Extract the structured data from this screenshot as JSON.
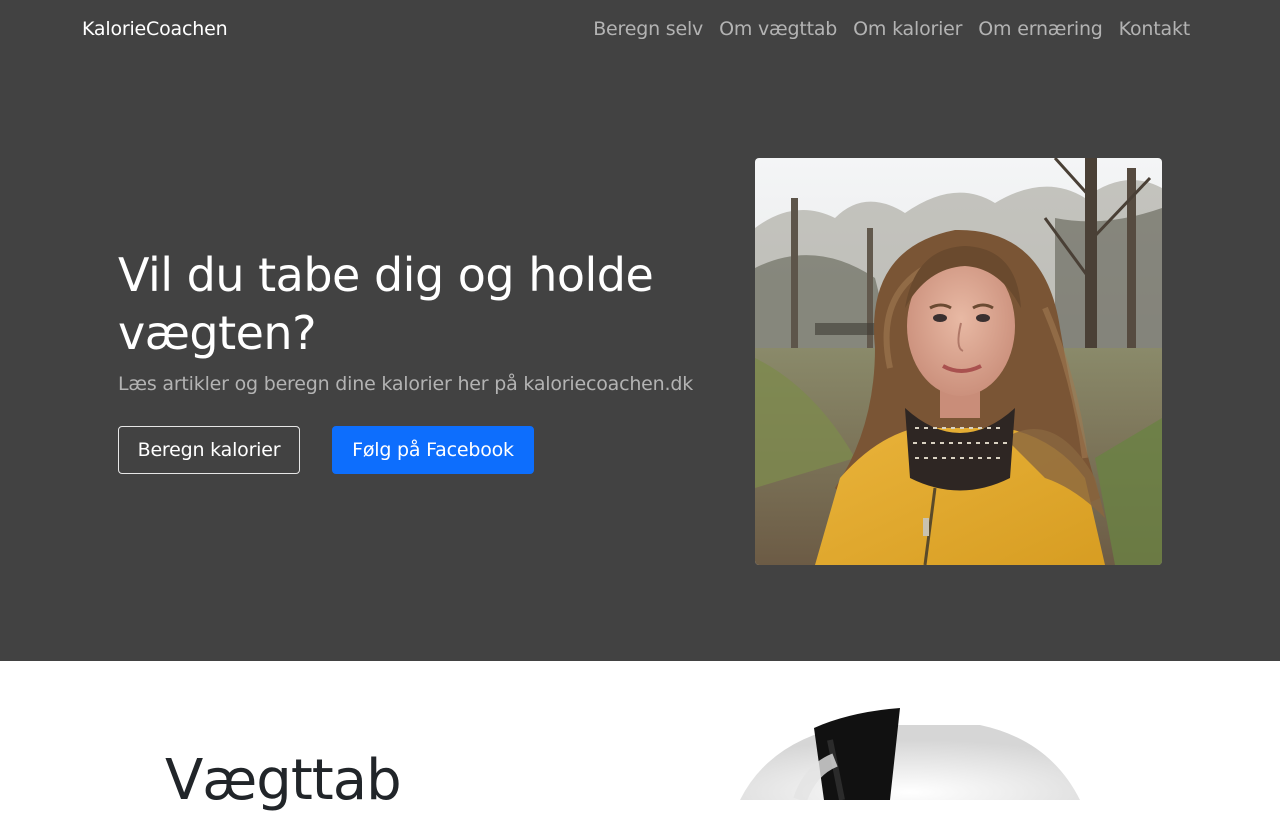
{
  "header": {
    "brand": "KalorieCoachen",
    "nav": [
      "Beregn selv",
      "Om vægttab",
      "Om kalorier",
      "Om ernæring",
      "Kontakt"
    ]
  },
  "hero": {
    "title": "Vil du tabe dig og holde vægten?",
    "subtitle": "Læs artikler og beregn dine kalorier her på kaloriecoachen.dk",
    "buttons": {
      "calculate": "Beregn kalorier",
      "facebook": "Følg på Facebook"
    }
  },
  "section": {
    "title": "Vægttab"
  },
  "colors": {
    "hero_background": "#424242",
    "primary_button": "#0d6efd",
    "muted_text": "#b3b3b3"
  }
}
